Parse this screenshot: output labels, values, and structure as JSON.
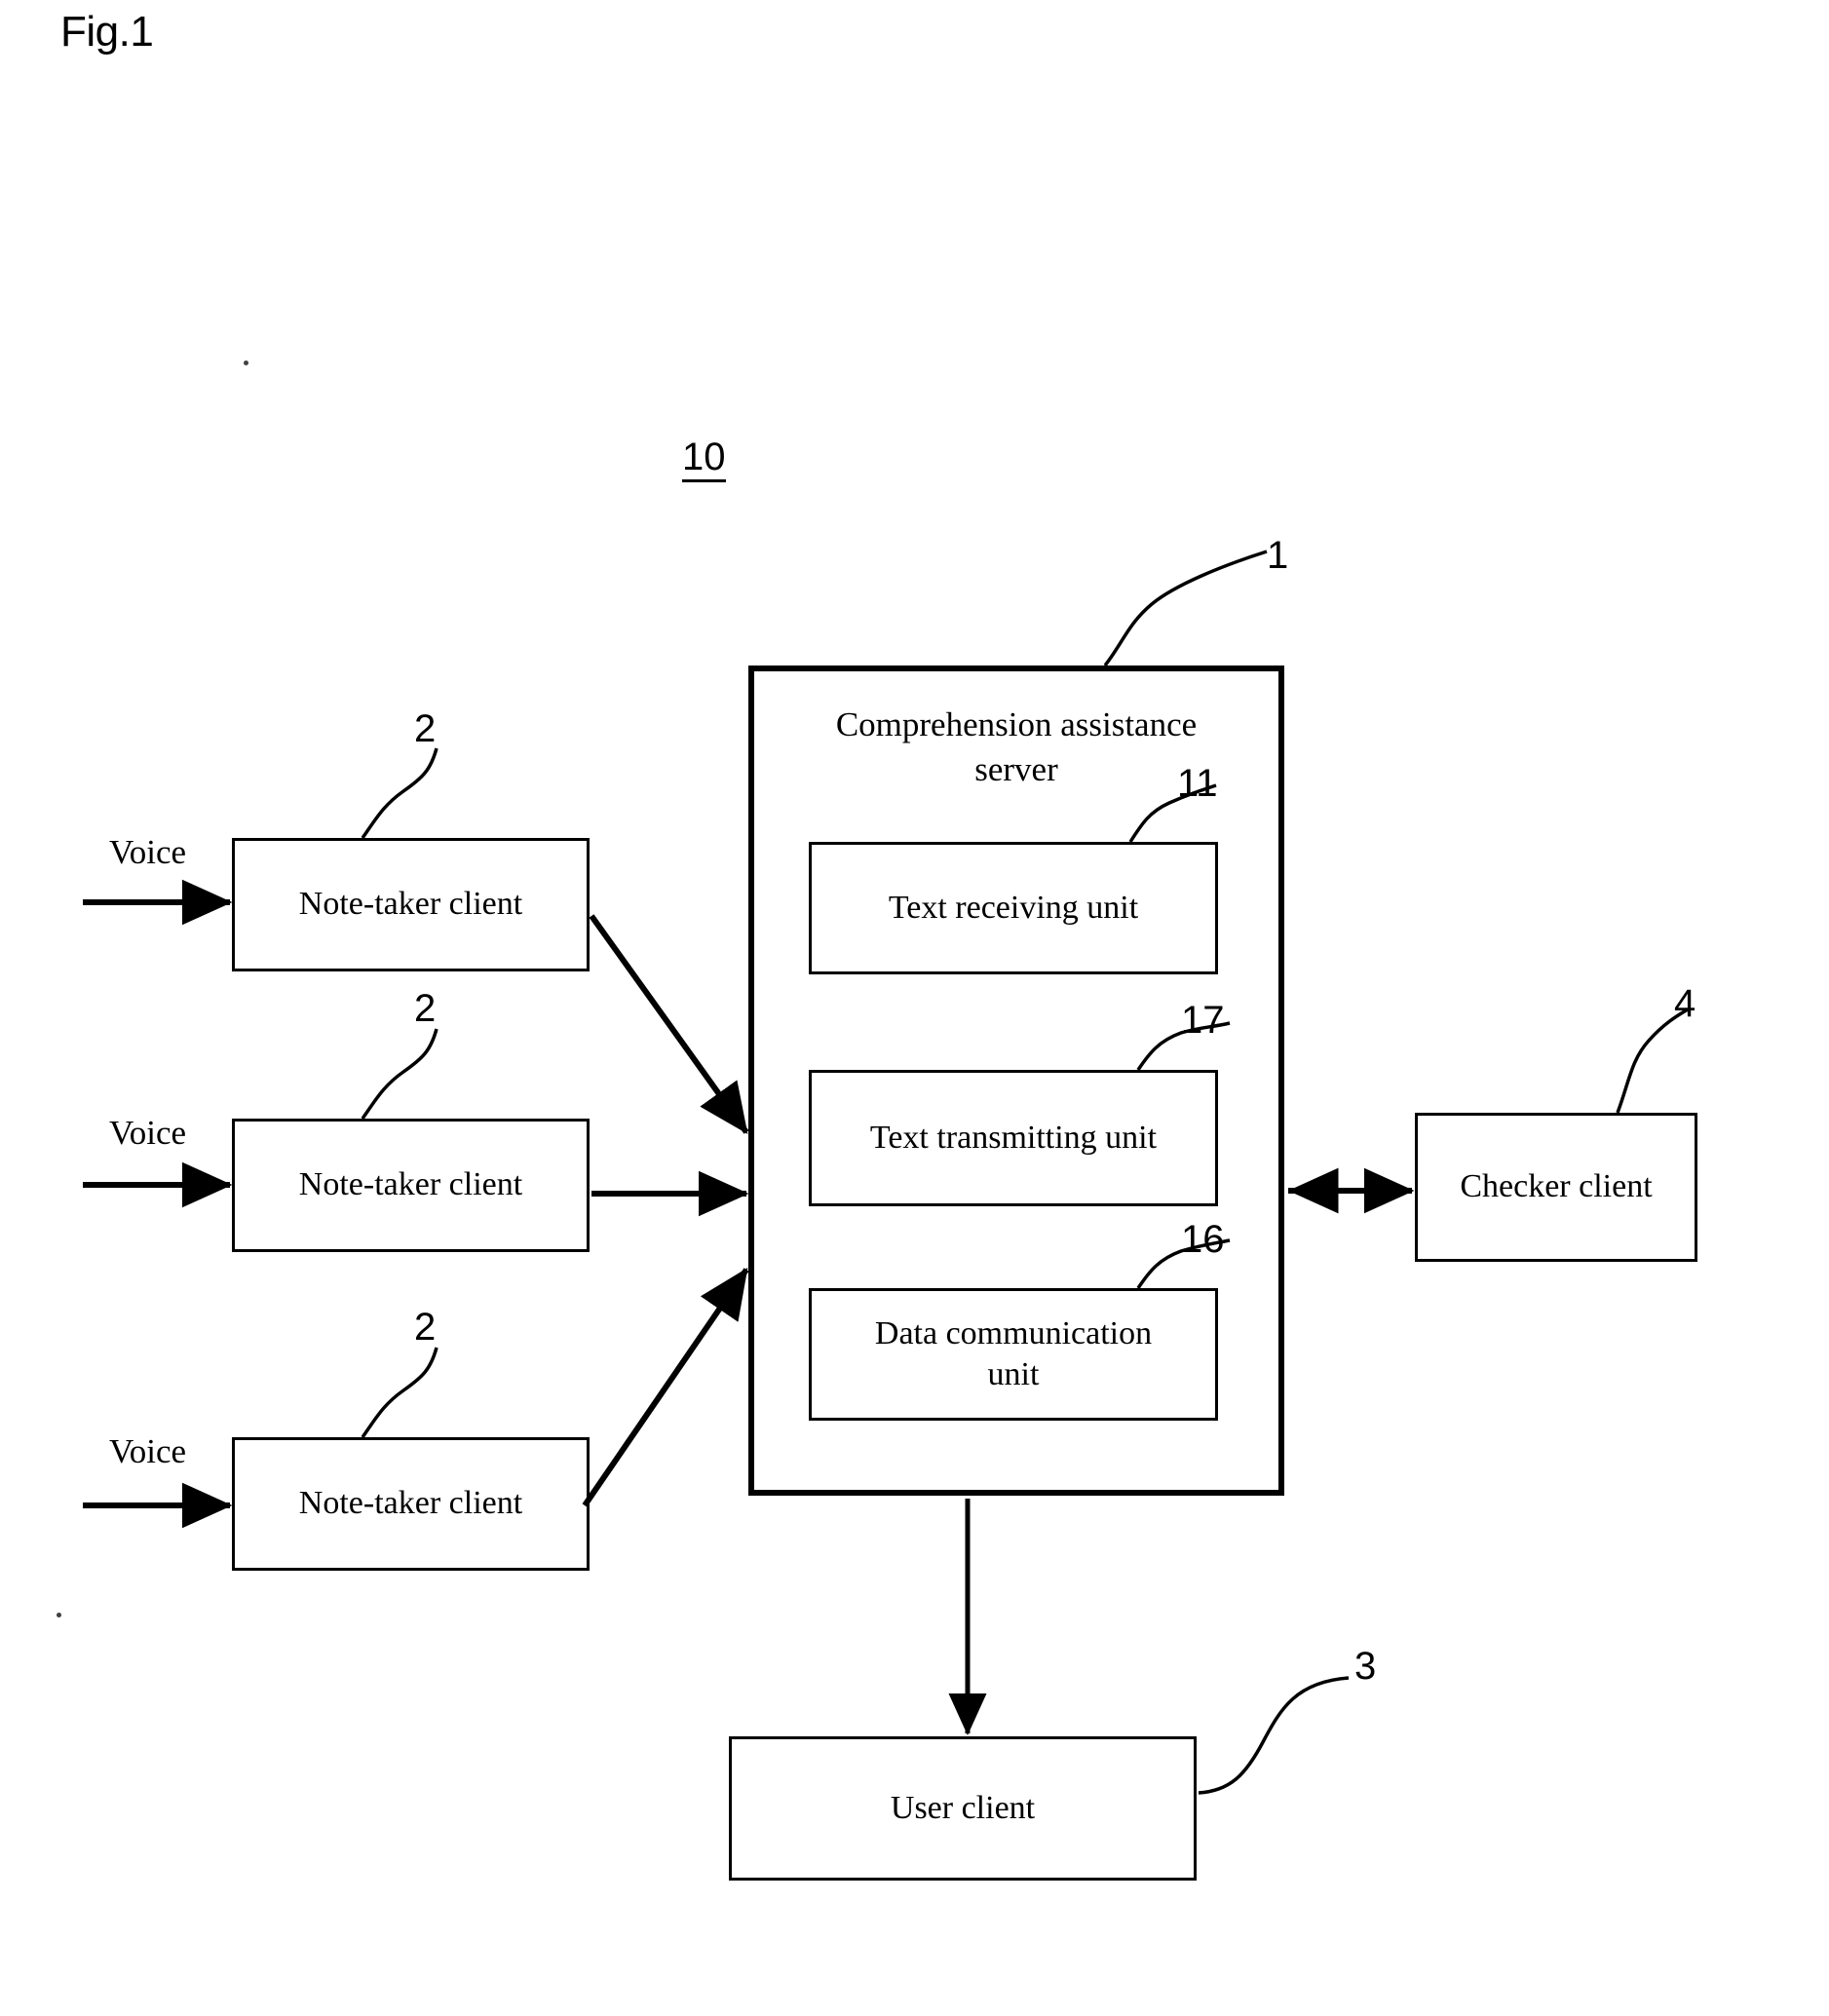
{
  "figure": {
    "label": "Fig.1",
    "system_ref": "10"
  },
  "server": {
    "title_line1": "Comprehension assistance",
    "title_line2": "server",
    "ref": "1",
    "units": [
      {
        "label": "Text receiving unit",
        "ref": "11"
      },
      {
        "label": "Text transmitting unit",
        "ref": "17"
      },
      {
        "label_line1": "Data communication",
        "label_line2": "unit",
        "ref": "16"
      }
    ]
  },
  "note_takers": [
    {
      "label": "Note-taker client",
      "ref": "2",
      "input_label": "Voice"
    },
    {
      "label": "Note-taker client",
      "ref": "2",
      "input_label": "Voice"
    },
    {
      "label": "Note-taker client",
      "ref": "2",
      "input_label": "Voice"
    }
  ],
  "checker_client": {
    "label": "Checker client",
    "ref": "4"
  },
  "user_client": {
    "label": "User client",
    "ref": "3"
  },
  "colors": {
    "ink": "#000000",
    "paper": "#ffffff"
  }
}
